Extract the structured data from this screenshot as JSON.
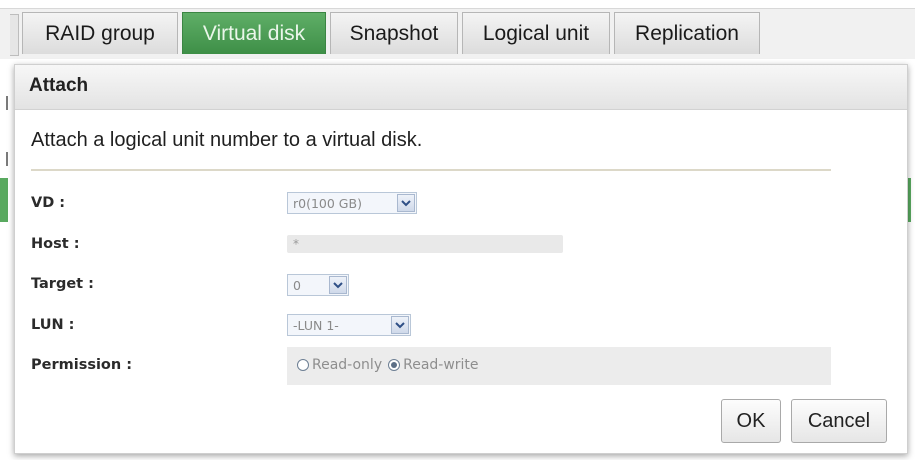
{
  "tabs": [
    {
      "label": "RAID group",
      "active": false
    },
    {
      "label": "Virtual disk",
      "active": true
    },
    {
      "label": "Snapshot",
      "active": false
    },
    {
      "label": "Logical unit",
      "active": false
    },
    {
      "label": "Replication",
      "active": false
    }
  ],
  "dialog": {
    "title": "Attach",
    "description": "Attach a logical unit number to a virtual disk.",
    "fields": {
      "vd": {
        "label": "VD :",
        "value": "r0(100 GB)"
      },
      "host": {
        "label": "Host :",
        "value": "*"
      },
      "target": {
        "label": "Target :",
        "value": "0"
      },
      "lun": {
        "label": "LUN :",
        "value": "-LUN 1-"
      },
      "permission": {
        "label": "Permission :",
        "options": [
          "Read-only",
          "Read-write"
        ],
        "selected": "Read-write"
      }
    },
    "ok_label": "OK",
    "cancel_label": "Cancel"
  },
  "colors": {
    "active_tab": "#4a9a52",
    "header_bg": "#ececec",
    "select_border": "#b9c7d8"
  }
}
